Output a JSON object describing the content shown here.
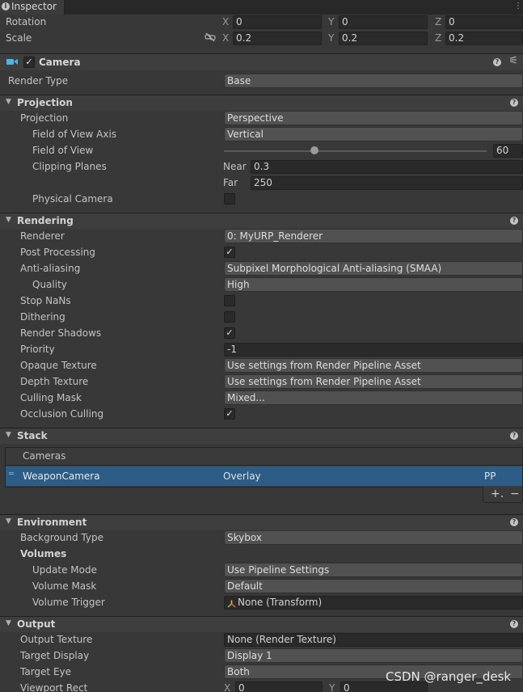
{
  "tab": {
    "label": "Inspector",
    "icon": "info-icon",
    "menu": "⋮"
  },
  "transform": {
    "rotation": {
      "label": "Rotation",
      "x": "0",
      "y": "0",
      "z": "0"
    },
    "scale": {
      "label": "Scale",
      "x": "0.2",
      "y": "0.2",
      "z": "0.2"
    },
    "axis": {
      "x": "X",
      "y": "Y",
      "z": "Z"
    }
  },
  "camera": {
    "title": "Camera",
    "enabled_mark": "✓",
    "render_type_label": "Render Type",
    "render_type": "Base"
  },
  "projection": {
    "title": "Projection",
    "projection_label": "Projection",
    "projection": "Perspective",
    "fov_axis_label": "Field of View Axis",
    "fov_axis": "Vertical",
    "fov_label": "Field of View",
    "fov": "60",
    "clip_label": "Clipping Planes",
    "near_label": "Near",
    "near": "0.3",
    "far_label": "Far",
    "far": "250",
    "physical_label": "Physical Camera"
  },
  "rendering": {
    "title": "Rendering",
    "renderer_label": "Renderer",
    "renderer": "0: MyURP_Renderer",
    "post_label": "Post Processing",
    "post_mark": "✓",
    "aa_label": "Anti-aliasing",
    "aa": "Subpixel Morphological Anti-aliasing (SMAA)",
    "quality_label": "Quality",
    "quality": "High",
    "nan_label": "Stop NaNs",
    "dither_label": "Dithering",
    "shadows_label": "Render Shadows",
    "shadows_mark": "✓",
    "priority_label": "Priority",
    "priority": "-1",
    "opaque_label": "Opaque Texture",
    "opaque": "Use settings from Render Pipeline Asset",
    "depth_label": "Depth Texture",
    "depth": "Use settings from Render Pipeline Asset",
    "culling_label": "Culling Mask",
    "culling": "Mixed...",
    "occlusion_label": "Occlusion Culling",
    "occlusion_mark": "✓"
  },
  "stack": {
    "title": "Stack",
    "header": "Cameras",
    "item": {
      "name": "WeaponCamera",
      "type": "Overlay",
      "tag": "PP"
    },
    "add": "+.",
    "remove": "−"
  },
  "environment": {
    "title": "Environment",
    "bg_label": "Background Type",
    "bg": "Skybox",
    "volumes_label": "Volumes",
    "update_label": "Update Mode",
    "update": "Use Pipeline Settings",
    "mask_label": "Volume Mask",
    "mask": "Default",
    "trigger_label": "Volume Trigger",
    "trigger": "None (Transform)"
  },
  "output": {
    "title": "Output",
    "texture_label": "Output Texture",
    "texture": "None (Render Texture)",
    "display_label": "Target Display",
    "display": "Display 1",
    "eye_label": "Target Eye",
    "eye": "Both",
    "viewport_label": "Viewport Rect",
    "vx": "0",
    "vy": "0"
  },
  "watermark": "CSDN @ranger_desk",
  "colors": {
    "background": "#383838",
    "selection": "#2c5d87",
    "header": "#3e3e3e"
  }
}
